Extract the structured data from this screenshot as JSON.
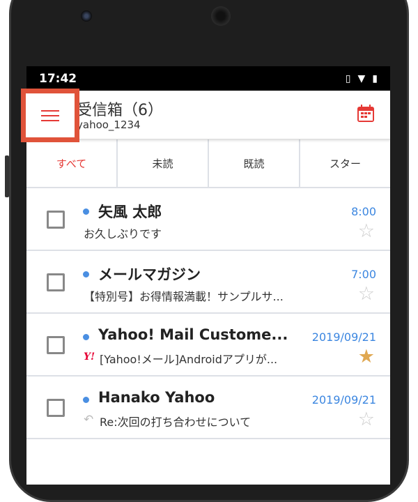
{
  "status_bar": {
    "time": "17:42",
    "icons": [
      "vibrate-icon",
      "wifi-icon",
      "battery-charging-icon"
    ]
  },
  "header": {
    "title": "受信箱（6）",
    "account": "yahoo_1234",
    "calendar_icon": "calendar-icon",
    "menu_icon": "hamburger-menu-icon"
  },
  "tabs": [
    {
      "label": "すべて",
      "active": true
    },
    {
      "label": "未読"
    },
    {
      "label": "既読"
    },
    {
      "label": "スター"
    }
  ],
  "colors": {
    "accent": "#e53935",
    "unread_dot": "#4a8fe2",
    "date": "#3b86e0",
    "star_on": "#e0a852",
    "highlight": "#e0533a"
  },
  "messages": [
    {
      "sender": "矢風 太郎",
      "date": "8:00",
      "subject": "お久しぶりです",
      "unread": true,
      "starred": false
    },
    {
      "sender": "メールマガジン",
      "date": "7:00",
      "subject": "【特別号】お得情報満載！サンプルサ...",
      "unread": true,
      "starred": false
    },
    {
      "sender": "Yahoo! Mail Custome...",
      "date": "2019/09/21",
      "subject": "[Yahoo!メール]Androidアプリが...",
      "unread": true,
      "starred": true,
      "prefix_icon": "yahoo-logo-icon",
      "prefix_text": "Y!"
    },
    {
      "sender": "Hanako Yahoo",
      "date": "2019/09/21",
      "subject": "Re:次回の打ち合わせについて",
      "unread": true,
      "starred": false,
      "prefix_icon": "reply-icon"
    }
  ]
}
